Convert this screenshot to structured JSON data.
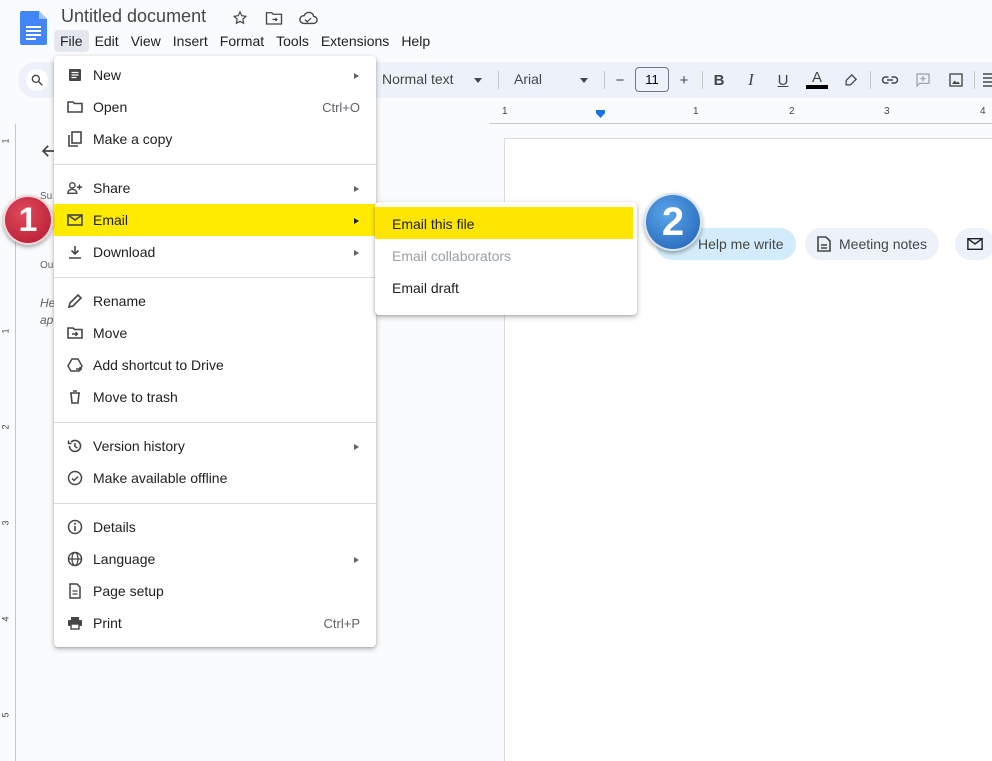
{
  "app": {
    "title": "Untitled document"
  },
  "menubar": [
    {
      "label": "File",
      "active": true
    },
    {
      "label": "Edit"
    },
    {
      "label": "View"
    },
    {
      "label": "Insert"
    },
    {
      "label": "Format"
    },
    {
      "label": "Tools"
    },
    {
      "label": "Extensions"
    },
    {
      "label": "Help"
    }
  ],
  "toolbar": {
    "style": "Normal text",
    "font": "Arial",
    "font_size": "11",
    "minus": "−",
    "plus": "+",
    "bold": "B",
    "italic": "I",
    "underline": "U",
    "text_color": "A"
  },
  "ruler": {
    "numbers": [
      "1",
      "1",
      "2",
      "3",
      "4"
    ]
  },
  "vruler": {
    "numbers": [
      "1",
      "1",
      "2",
      "3",
      "4",
      "5"
    ]
  },
  "sidebar": {
    "summary_label": "Su",
    "outline_label": "Ou",
    "hint_line1": "He",
    "hint_line2": "ap"
  },
  "file_menu": {
    "items": [
      {
        "label": "New",
        "icon": "doc-icon",
        "submenu": true
      },
      {
        "label": "Open",
        "icon": "folder-icon",
        "shortcut": "Ctrl+O"
      },
      {
        "label": "Make a copy",
        "icon": "copy-icon"
      },
      {
        "label": "Share",
        "icon": "person-add-icon",
        "submenu": true
      },
      {
        "label": "Email",
        "icon": "mail-icon",
        "submenu": true,
        "highlighted": true
      },
      {
        "label": "Download",
        "icon": "download-icon",
        "submenu": true
      },
      {
        "label": "Rename",
        "icon": "pencil-icon"
      },
      {
        "label": "Move",
        "icon": "move-folder-icon"
      },
      {
        "label": "Add shortcut to Drive",
        "icon": "drive-shortcut-icon"
      },
      {
        "label": "Move to trash",
        "icon": "trash-icon"
      },
      {
        "label": "Version history",
        "icon": "history-icon",
        "submenu": true
      },
      {
        "label": "Make available offline",
        "icon": "offline-icon"
      },
      {
        "label": "Details",
        "icon": "info-icon"
      },
      {
        "label": "Language",
        "icon": "globe-icon",
        "submenu": true
      },
      {
        "label": "Page setup",
        "icon": "page-icon"
      },
      {
        "label": "Print",
        "icon": "print-icon",
        "shortcut": "Ctrl+P"
      }
    ]
  },
  "email_submenu": {
    "items": [
      {
        "label": "Email this file",
        "highlighted": true
      },
      {
        "label": "Email collaborators",
        "disabled": true
      },
      {
        "label": "Email draft"
      }
    ]
  },
  "chips": {
    "help_me_write": "Help me write",
    "meeting_notes": "Meeting notes"
  },
  "badges": {
    "step1": "1",
    "step2": "2"
  },
  "colors": {
    "highlight": "#ffeb00",
    "badge1": "#c41e3a",
    "badge2": "#2f7bd0",
    "doc_blue": "#4285f4"
  }
}
